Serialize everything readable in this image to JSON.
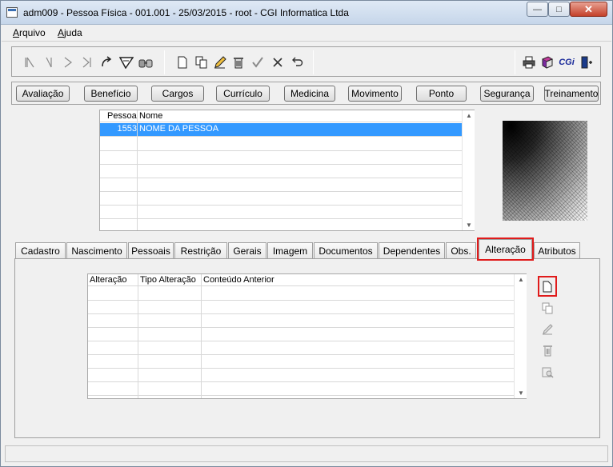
{
  "window": {
    "title": "adm009 - Pessoa Física - 001.001 - 25/03/2015 - root - CGI Informatica Ltda",
    "min_glyph": "—",
    "max_glyph": "□",
    "close_glyph": "✕"
  },
  "menu": {
    "arquivo_ul": "A",
    "arquivo_rest": "rquivo",
    "ajuda_ul": "A",
    "ajuda_rest": "juda"
  },
  "toolbar": {
    "left_icons": [
      "first-record-icon",
      "previous-record-icon",
      "next-record-icon",
      "last-record-icon",
      "go-to-icon",
      "filter-icon",
      "search-binoculars-icon"
    ],
    "edit_icons": [
      "new-document-icon",
      "copy-icon",
      "edit-pencil-icon",
      "delete-trash-icon",
      "confirm-check-icon",
      "cancel-x-icon",
      "undo-icon"
    ],
    "right_icons": [
      "print-icon",
      "book-icon",
      "cgi-logo-icon",
      "exit-door-icon"
    ],
    "cgi_text": "CGi"
  },
  "nav_buttons": [
    "Avaliação",
    "Benefício",
    "Cargos",
    "Currículo",
    "Medicina",
    "Movimento",
    "Ponto",
    "Segurança",
    "Treinamento"
  ],
  "person_grid": {
    "headers": [
      "Pessoa",
      "Nome"
    ],
    "rows": [
      {
        "pessoa": "1553",
        "nome": "NOME DA PESSOA"
      }
    ]
  },
  "tabs": [
    "Cadastro",
    "Nascimento",
    "Pessoais",
    "Restrição",
    "Gerais",
    "Imagem",
    "Documentos",
    "Dependentes",
    "Obs.",
    "Alteração",
    "Atributos"
  ],
  "active_tab": "Alteração",
  "alteracao_grid": {
    "headers": [
      "Alteração",
      "Tipo Alteração",
      "Conteúdo Anterior"
    ]
  },
  "side_actions": [
    "new-record-icon",
    "copy-record-icon",
    "edit-record-icon",
    "delete-record-icon",
    "view-record-icon"
  ]
}
